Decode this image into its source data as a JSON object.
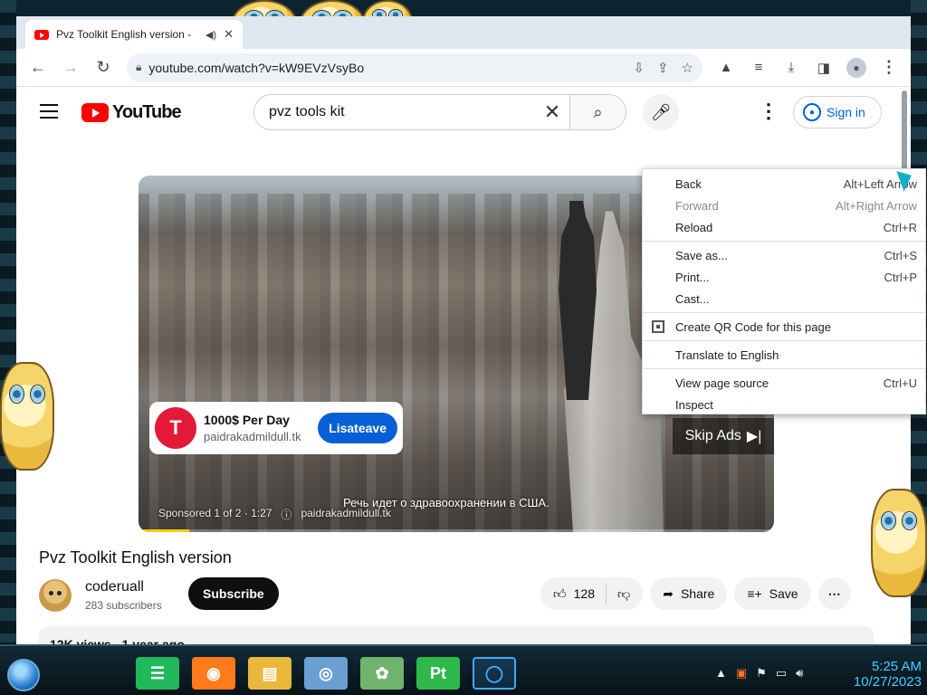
{
  "browser": {
    "tab": {
      "title": "Pvz Toolkit English version -",
      "audio_icon": "speaker-icon",
      "close_icon": "close-icon"
    },
    "url": "youtube.com/watch?v=kW9EVzVsyBo"
  },
  "youtube": {
    "logo_text": "YouTube",
    "search_value": "pvz tools kit",
    "sign_in": "Sign in",
    "ad": {
      "logo_glyph": "T",
      "title": "1000$ Per Day",
      "domain": "paidrakadmildull.tk",
      "cta": "Lisateave",
      "skip": "Skip Ads",
      "subtitle": "Речь идет о здравоохранении в США.",
      "sponsored": "Sponsored 1 of 2 · 1:27",
      "meta_domain": "paidrakadmildull.tk",
      "progress": 0.08
    },
    "video_title": "Pvz Toolkit English version",
    "channel": {
      "name": "coderuall",
      "subscribers": "283 subscribers",
      "subscribe": "Subscribe"
    },
    "actions": {
      "likes": "128",
      "share": "Share",
      "save": "Save"
    },
    "description": {
      "views": "12K views",
      "age": "1 year ago"
    }
  },
  "context_menu": {
    "groups": [
      [
        {
          "label": "Back",
          "shortcut": "Alt+Left Arrow",
          "disabled": false
        },
        {
          "label": "Forward",
          "shortcut": "Alt+Right Arrow",
          "disabled": true
        },
        {
          "label": "Reload",
          "shortcut": "Ctrl+R",
          "disabled": false
        }
      ],
      [
        {
          "label": "Save as...",
          "shortcut": "Ctrl+S",
          "disabled": false
        },
        {
          "label": "Print...",
          "shortcut": "Ctrl+P",
          "disabled": false
        },
        {
          "label": "Cast...",
          "shortcut": "",
          "disabled": false
        }
      ],
      [
        {
          "label": "Create QR Code for this page",
          "shortcut": "",
          "disabled": false,
          "icon": "qr-code-icon"
        }
      ],
      [
        {
          "label": "Translate to English",
          "shortcut": "",
          "disabled": false
        }
      ],
      [
        {
          "label": "View page source",
          "shortcut": "Ctrl+U",
          "disabled": false
        },
        {
          "label": "Inspect",
          "shortcut": "",
          "disabled": false
        }
      ]
    ]
  },
  "taskbar": {
    "apps": [
      {
        "name": "notes-app",
        "glyph": "☰",
        "color": "#1fb85a"
      },
      {
        "name": "firefox",
        "glyph": "◉",
        "color": "#ff7a1a"
      },
      {
        "name": "file-explorer",
        "glyph": "▤",
        "color": "#e9b83a"
      },
      {
        "name": "media-player",
        "glyph": "◎",
        "color": "#6a9fd4"
      },
      {
        "name": "photo-app",
        "glyph": "✿",
        "color": "#6fb36f"
      },
      {
        "name": "pt-app",
        "glyph": "Pt",
        "color": "#2fb84a"
      },
      {
        "name": "chrome",
        "glyph": "◯",
        "color": "#3fa9ff",
        "active": true
      }
    ],
    "time": "5:25 AM",
    "date": "10/27/2023"
  }
}
